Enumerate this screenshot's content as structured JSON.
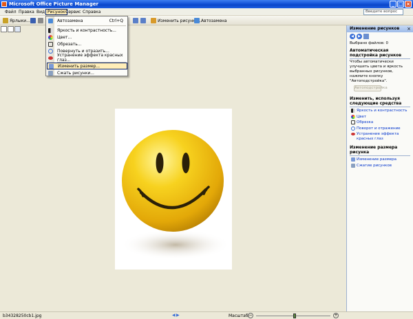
{
  "window": {
    "title": "Microsoft Office Picture Manager",
    "minimize": "_",
    "maximize": "□",
    "close": "×"
  },
  "menubar": {
    "items": [
      "Файл",
      "Правка",
      "Вид",
      "Рисунок",
      "Сервис",
      "Справка"
    ],
    "ask_placeholder": "Введите вопрос"
  },
  "toolbar": {
    "shortcuts": "Ярлыки...",
    "edit_pictures": "Изменить рисунки...",
    "autocorrect": "Автозамена"
  },
  "picture_menu": {
    "items": [
      {
        "label": "Автозамена",
        "shortcut": "Ctrl+Q",
        "icon": "autocorrect-icon"
      },
      {
        "label": "Яркость и контрастность...",
        "shortcut": "",
        "icon": "brightness-icon"
      },
      {
        "label": "Цвет...",
        "shortcut": "",
        "icon": "color-icon"
      },
      {
        "label": "Обрезать...",
        "shortcut": "",
        "icon": "crop-icon"
      },
      {
        "label": "Повернуть и отразить...",
        "shortcut": "",
        "icon": "rotate-icon"
      },
      {
        "label": "Устранение эффекта красных глаз...",
        "shortcut": "",
        "icon": "redeye-icon"
      },
      {
        "label": "Изменить размер...",
        "shortcut": "",
        "icon": "resize-icon"
      },
      {
        "label": "Сжать рисунки...",
        "shortcut": "",
        "icon": "compress-icon"
      }
    ],
    "highlighted_index": 6
  },
  "taskpane": {
    "title": "Изменение рисунков",
    "selected_files": "Выбрано файлов: 0",
    "auto_section": "Автоматическая подстройка рисунков",
    "auto_description": "Чтобы автоматически улучшить цвета и яркость выбранных рисунков, нажмите кнопку \"Автоподстройка\".",
    "auto_button": "Автоподстройка",
    "tools_section": "Изменить, используя следующие средства",
    "tools": [
      {
        "label": "Яркость и контрастность",
        "icon": "brightness-icon"
      },
      {
        "label": "Цвет",
        "icon": "color-icon"
      },
      {
        "label": "Обрезка",
        "icon": "crop-icon"
      },
      {
        "label": "Поворот и отражение",
        "icon": "rotate-icon"
      },
      {
        "label": "Устранение эффекта красных глаз",
        "icon": "redeye-icon"
      }
    ],
    "resize_section": "Изменение размера рисунка",
    "resize_tools": [
      {
        "label": "Изменение размера",
        "icon": "resize-icon"
      },
      {
        "label": "Сжатие рисунков",
        "icon": "compress-icon"
      }
    ]
  },
  "status": {
    "filename": "b34328250cb1.jpg",
    "zoom_label": "Масштаб:",
    "zoom_level": 0.52
  },
  "colors": {
    "title_bar": "#0a45c8",
    "menu_highlight": "#ffeeb8",
    "link": "#0033cc",
    "smiley": "#f2c31a"
  }
}
